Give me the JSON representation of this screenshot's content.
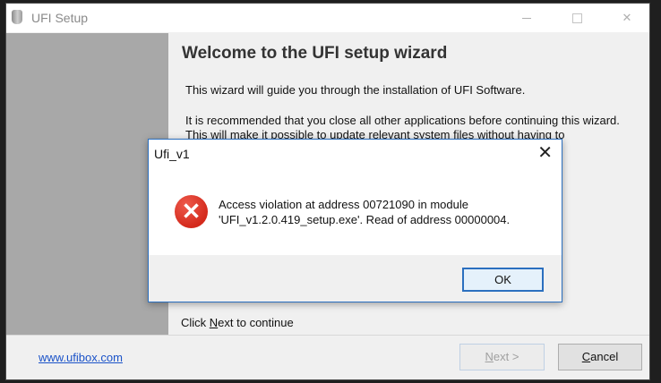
{
  "setup_window": {
    "title": "UFI Setup",
    "heading": "Welcome to the UFI setup wizard",
    "paragraph1": "This wizard will guide you through the installation of UFI Software.",
    "paragraph2": "It is recommended that you close all other applications before continuing this wizard. This will make it possible to update relevant system files without having to",
    "click_next_prefix": "Click ",
    "click_next_mnemonic": "N",
    "click_next_suffix": "ext to continue",
    "footer_link": "www.ufibox.com",
    "next_mnemonic": "N",
    "next_rest": "ext >",
    "cancel_mnemonic": "C",
    "cancel_rest": "ancel"
  },
  "dialog": {
    "title": "Ufi_v1",
    "message_line1": "Access violation at address 00721090 in module",
    "message_line2": "'UFI_v1.2.0.419_setup.exe'. Read of address 00000004.",
    "ok_label": "OK",
    "icon": "error-icon"
  },
  "colors": {
    "sidebar": "#a8a8a8",
    "link": "#1a52c8",
    "error": "#d42a1c",
    "accent": "#2b6fbf"
  }
}
